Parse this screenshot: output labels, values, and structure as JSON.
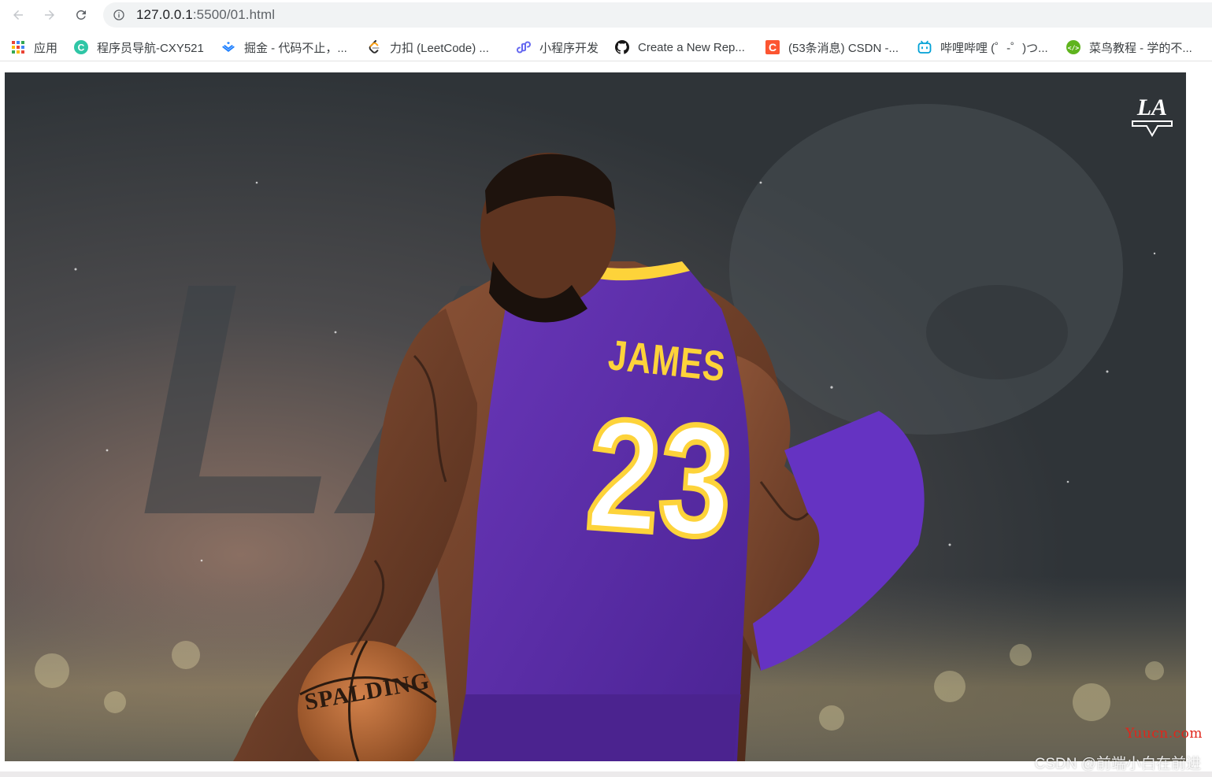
{
  "browser": {
    "url_host": "127.0.0.1",
    "url_path": ":5500/01.html",
    "back_icon": "arrow-left-icon",
    "forward_icon": "arrow-right-icon",
    "reload_icon": "reload-icon",
    "info_icon": "info-icon"
  },
  "bookmarks": [
    {
      "label": "应用",
      "icon": "apps-grid-icon",
      "color": "#ea4335"
    },
    {
      "label": "程序员导航-CXY521",
      "icon": "cxy-c-icon",
      "color": "#2fc6a6"
    },
    {
      "label": "掘金 - 代码不止，...",
      "icon": "juejin-icon",
      "color": "#1e80ff"
    },
    {
      "label": "力扣 (LeetCode) ...",
      "icon": "leetcode-icon",
      "color": "#ffa116"
    },
    {
      "label": "小程序开发",
      "icon": "miniprogram-icon",
      "color": "#6467f0"
    },
    {
      "label": "Create a New Rep...",
      "icon": "github-icon",
      "color": "#181717"
    },
    {
      "label": "(53条消息) CSDN -...",
      "icon": "csdn-icon",
      "color": "#fc5531"
    },
    {
      "label": "哔哩哔哩 (゜-゜)つ...",
      "icon": "bilibili-icon",
      "color": "#00a1d6"
    },
    {
      "label": "菜鸟教程 - 学的不...",
      "icon": "runoob-icon",
      "color": "#5fb41e"
    }
  ],
  "content": {
    "jersey_name": "JAMES",
    "jersey_number": "23",
    "ball_brand": "SPALDING",
    "team_logo_text": "LA",
    "jersey_color": "#5b2ea6",
    "accent_color": "#fdd33a"
  },
  "watermarks": {
    "site": "Yuucn.com",
    "csdn": "CSDN @前端小白在前进"
  }
}
